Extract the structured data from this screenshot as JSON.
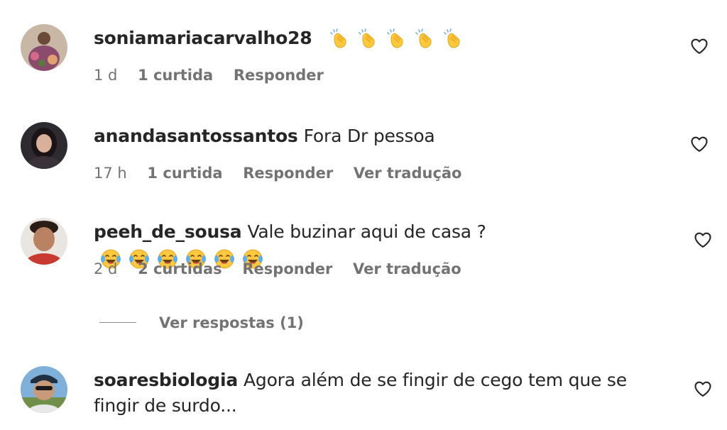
{
  "comments": [
    {
      "username": "soniamariacarvalho28",
      "text": "",
      "emoji": "clapping-hands",
      "emoji_count": 5,
      "time": "1 d",
      "likes": "1 curtida",
      "reply": "Responder",
      "translate": ""
    },
    {
      "username": "anandasantossantos",
      "text": "Fora Dr pessoa",
      "emoji": "",
      "emoji_count": 0,
      "time": "17 h",
      "likes": "1 curtida",
      "reply": "Responder",
      "translate": "Ver tradução"
    },
    {
      "username": "peeh_de_sousa",
      "text": "Vale buzinar aqui de casa ?",
      "emoji": "face-with-tears-of-joy",
      "emoji_count": 6,
      "time": "2 d",
      "likes": "2 curtidas",
      "reply": "Responder",
      "translate": "Ver tradução"
    },
    {
      "username": "soaresbiologia",
      "text": "Agora além de se fingir de cego tem que se fingir de surdo...",
      "emoji": "",
      "emoji_count": 0,
      "time": "",
      "likes": "",
      "reply": "",
      "translate": ""
    }
  ],
  "view_replies": "Ver respostas (1)",
  "colors": {
    "text": "#262626",
    "secondary": "#737373",
    "emoji_yellow": "#FFC83D"
  }
}
